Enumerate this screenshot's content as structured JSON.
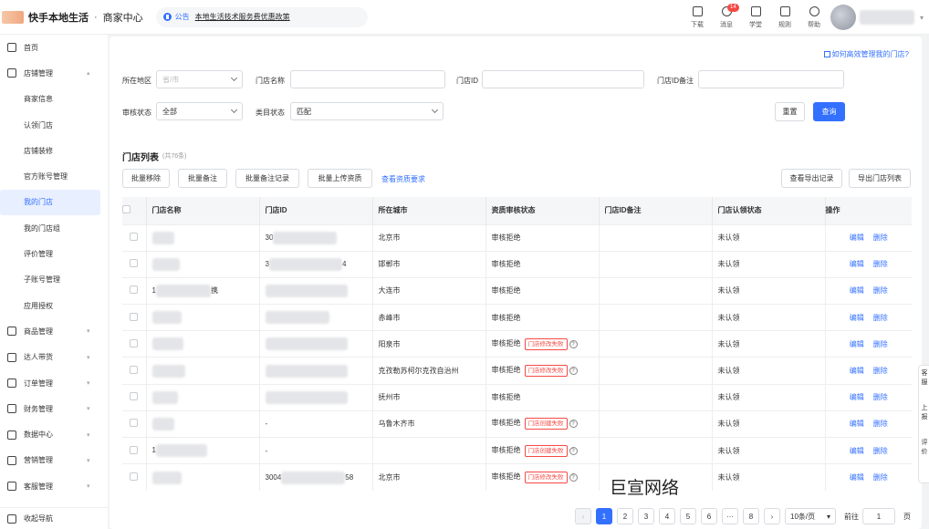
{
  "topbar": {
    "app_title": "快手本地生活",
    "separator": "·",
    "app_sub": "商家中心",
    "notice_tag": "公告",
    "notice_text": "本地生活技术服务费优惠政策",
    "icons": [
      {
        "name": "download-icon",
        "label": "下载"
      },
      {
        "name": "bell-icon",
        "label": "消息",
        "badge": "14"
      },
      {
        "name": "graduation-cap-icon",
        "label": "学堂"
      },
      {
        "name": "rules-icon",
        "label": "规则"
      },
      {
        "name": "help-icon",
        "label": "帮助"
      }
    ]
  },
  "sidebar": {
    "items": [
      {
        "label": "首页",
        "icon": "home-icon",
        "type": "top"
      },
      {
        "label": "店铺管理",
        "icon": "store-icon",
        "type": "top",
        "expanded": true
      },
      {
        "label": "商家信息",
        "type": "sub"
      },
      {
        "label": "认领门店",
        "type": "sub"
      },
      {
        "label": "店铺装修",
        "type": "sub"
      },
      {
        "label": "官方账号管理",
        "type": "sub"
      },
      {
        "label": "我的门店",
        "type": "sub",
        "active": true
      },
      {
        "label": "我的门店组",
        "type": "sub"
      },
      {
        "label": "评价管理",
        "type": "sub"
      },
      {
        "label": "子账号管理",
        "type": "sub"
      },
      {
        "label": "应用授权",
        "type": "sub"
      },
      {
        "label": "商品管理",
        "icon": "cart-icon",
        "type": "top"
      },
      {
        "label": "达人带货",
        "icon": "person-icon",
        "type": "top"
      },
      {
        "label": "订单管理",
        "icon": "order-icon",
        "type": "top"
      },
      {
        "label": "财务管理",
        "icon": "wallet-icon",
        "type": "top"
      },
      {
        "label": "数据中心",
        "icon": "chart-icon",
        "type": "top"
      },
      {
        "label": "营销管理",
        "icon": "tag-icon",
        "type": "top"
      },
      {
        "label": "客服管理",
        "icon": "headset-icon",
        "type": "top"
      }
    ],
    "collapse_label": "收起导航"
  },
  "filters": {
    "help_link": "如何高效管理我的门店?",
    "region_label": "所在地区",
    "region_placeholder": "省/市",
    "store_name_label": "门店名称",
    "store_id_label": "门店ID",
    "store_id_note_label": "门店ID备注",
    "audit_status_label": "审核状态",
    "audit_status_value": "全部",
    "category_status_label": "类目状态",
    "category_status_value": "匹配",
    "reset_label": "重置",
    "query_label": "查询"
  },
  "list": {
    "title": "门店列表",
    "count": "(共76条)",
    "actions": [
      "批量移除",
      "批量备注",
      "批量备注记录",
      "批量上传资质"
    ],
    "view_requirements": "查看资质要求",
    "export_records": "查看导出记录",
    "export_list": "导出门店列表",
    "columns": [
      "门店名称",
      "门店ID",
      "所在城市",
      "资质审核状态",
      "门店ID备注",
      "门店认领状态",
      "操作"
    ],
    "rows": [
      {
        "id_text": "30",
        "city": "北京市",
        "audit": "审核拒绝",
        "tag": "",
        "claim": "未认领"
      },
      {
        "id_text": "3",
        "id_suffix": "4",
        "city": "邯郸市",
        "audit": "审核拒绝",
        "tag": "",
        "claim": "未认领"
      },
      {
        "name_prefix": "1",
        "name_suffix": "携",
        "city": "大连市",
        "audit": "审核拒绝",
        "tag": "",
        "claim": "未认领"
      },
      {
        "city": "赤峰市",
        "audit": "审核拒绝",
        "tag": "",
        "claim": "未认领"
      },
      {
        "city": "阳泉市",
        "audit": "审核拒绝",
        "tag": "门店修改失败",
        "claim": "未认领"
      },
      {
        "city": "克孜勒苏柯尔克孜自治州",
        "audit": "审核拒绝",
        "tag": "门店修改失败",
        "claim": "未认领"
      },
      {
        "city": "抚州市",
        "audit": "审核拒绝",
        "tag": "",
        "claim": "未认领"
      },
      {
        "id_text": "-",
        "city": "乌鲁木齐市",
        "audit": "审核拒绝",
        "tag": "门店创建失败",
        "claim": "未认领"
      },
      {
        "name_prefix": "1",
        "id_text": "-",
        "city": "",
        "audit": "审核拒绝",
        "tag": "门店创建失败",
        "claim": "未认领"
      },
      {
        "id_text": "3004",
        "id_suffix": "58",
        "city": "北京市",
        "audit": "审核拒绝",
        "tag": "门店修改失败",
        "claim": "未认领"
      }
    ],
    "edit_label": "编辑",
    "delete_label": "删除"
  },
  "pagination": {
    "pages": [
      "1",
      "2",
      "3",
      "4",
      "5",
      "6",
      "···",
      "8"
    ],
    "current": "1",
    "page_size": "10条/页",
    "goto_label": "前往",
    "goto_value": "1",
    "page_suffix": "页"
  },
  "watermark": "巨宣网络",
  "side_float": [
    "客服",
    "上报",
    "评价"
  ]
}
